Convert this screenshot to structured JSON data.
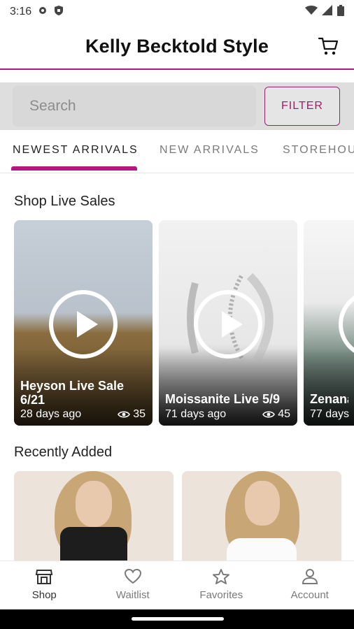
{
  "status_bar": {
    "time": "3:16",
    "icons": [
      "settings-gear-icon",
      "shield-icon",
      "wifi-icon",
      "signal-icon",
      "battery-icon"
    ]
  },
  "header": {
    "title": "Kelly Becktold Style",
    "cart_icon": "cart-icon",
    "accent_color": "#b5177e"
  },
  "search": {
    "placeholder": "Search",
    "filter_label": "FILTER"
  },
  "tabs": [
    {
      "label": "NEWEST ARRIVALS",
      "active": true
    },
    {
      "label": "NEW ARRIVALS",
      "active": false
    },
    {
      "label": "STOREHOU",
      "active": false
    }
  ],
  "live_section": {
    "title": "Shop Live Sales",
    "cards": [
      {
        "title": "Heyson Live Sale 6/21",
        "age": "28 days ago",
        "views": "35"
      },
      {
        "title": "Moissanite Live 5/9",
        "age": "71 days ago",
        "views": "45"
      },
      {
        "title": "Zenana",
        "age": "77 days",
        "views": ""
      }
    ]
  },
  "recent_section": {
    "title": "Recently Added"
  },
  "bottom_nav": [
    {
      "label": "Shop",
      "icon": "shop-icon",
      "active": true
    },
    {
      "label": "Waitlist",
      "icon": "heart-icon",
      "active": false
    },
    {
      "label": "Favorites",
      "icon": "star-icon",
      "active": false
    },
    {
      "label": "Account",
      "icon": "person-icon",
      "active": false
    }
  ]
}
